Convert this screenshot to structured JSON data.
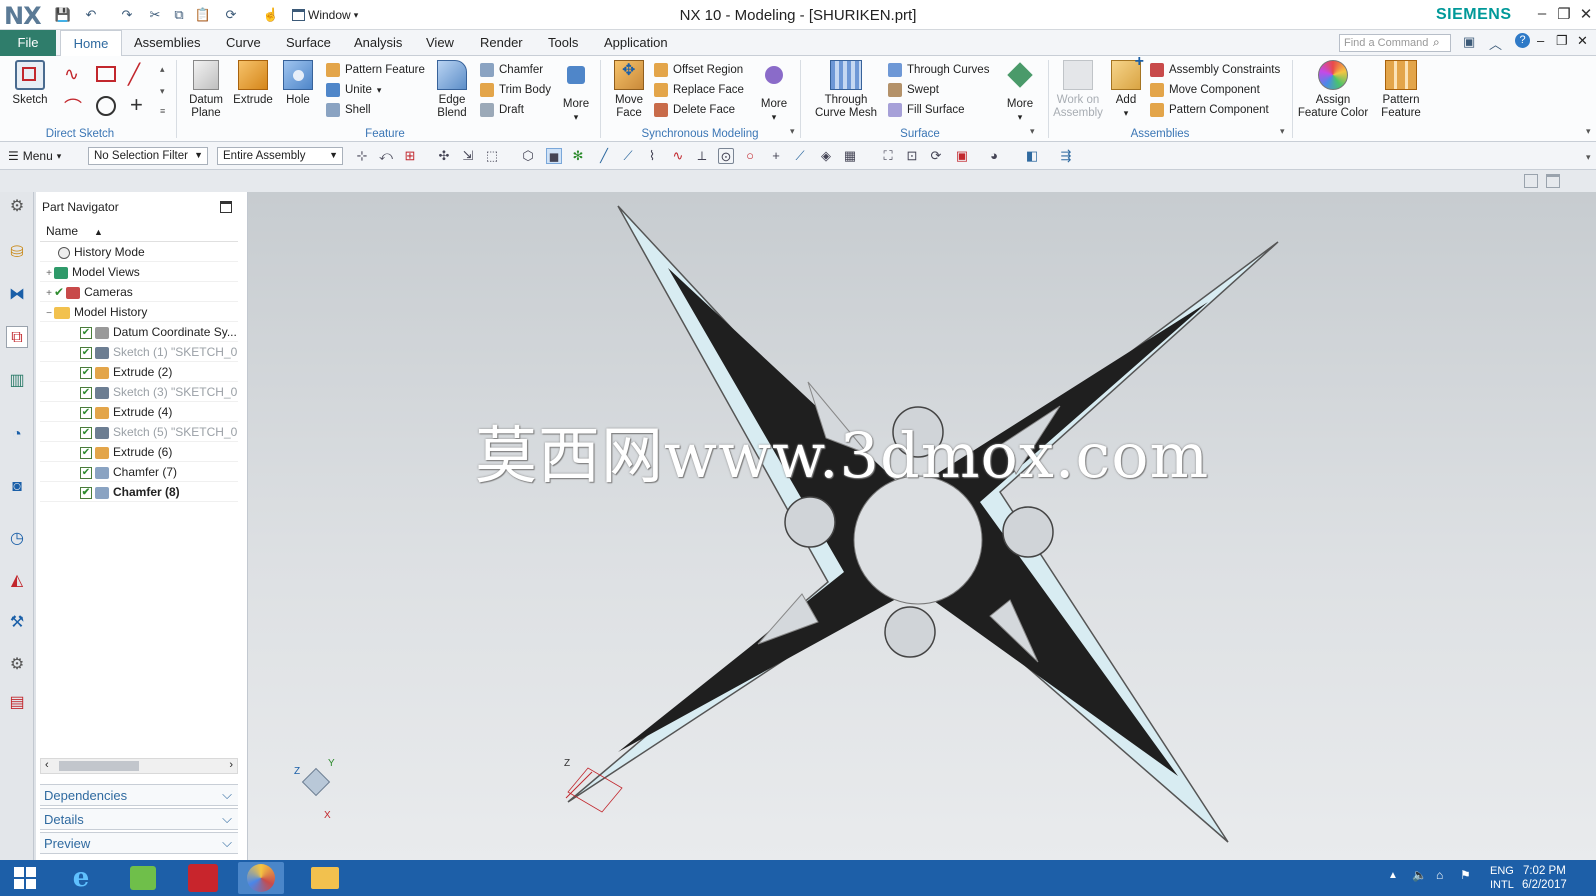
{
  "titlebar": {
    "app_logo": "NX",
    "window_menu": "Window",
    "title": "NX 10 - Modeling - [SHURIKEN.prt]",
    "brand": "SIEMENS"
  },
  "menu_tabs": [
    "File",
    "Home",
    "Assemblies",
    "Curve",
    "Surface",
    "Analysis",
    "View",
    "Render",
    "Tools",
    "Application"
  ],
  "active_tab": "Home",
  "find_command_placeholder": "Find a Command",
  "ribbon": {
    "sketch": "Sketch",
    "direct_sketch_group": "Direct Sketch",
    "datum_plane": [
      "Datum",
      "Plane"
    ],
    "extrude": "Extrude",
    "hole": "Hole",
    "pattern_feature": "Pattern Feature",
    "unite": "Unite",
    "shell": "Shell",
    "edge_blend": [
      "Edge",
      "Blend"
    ],
    "chamfer": "Chamfer",
    "trim_body": "Trim Body",
    "draft": "Draft",
    "more1": "More",
    "feature_group": "Feature",
    "move_face": [
      "Move",
      "Face"
    ],
    "offset_region": "Offset Region",
    "replace_face": "Replace Face",
    "delete_face": "Delete Face",
    "more2": "More",
    "sync_group": "Synchronous Modeling",
    "through_curve_mesh": [
      "Through",
      "Curve Mesh"
    ],
    "through_curves": "Through Curves",
    "swept": "Swept",
    "fill_surface": "Fill Surface",
    "more3": "More",
    "surface_group": "Surface",
    "work_on_assembly": [
      "Work on",
      "Assembly"
    ],
    "add": "Add",
    "assembly_constraints": "Assembly Constraints",
    "move_component": "Move Component",
    "pattern_component": "Pattern Component",
    "assemblies_group": "Assemblies",
    "assign_feature_color": [
      "Assign",
      "Feature Color"
    ],
    "pattern_feature_big": [
      "Pattern",
      "Feature"
    ]
  },
  "toolbar2": {
    "menu": "Menu",
    "selection_filter": "No Selection Filter",
    "scope": "Entire Assembly"
  },
  "navigator": {
    "title": "Part Navigator",
    "column": "Name",
    "items": [
      {
        "label": "History Mode",
        "expander": "",
        "checked": false
      },
      {
        "label": "Model Views",
        "expander": "+",
        "checked": false
      },
      {
        "label": "Cameras",
        "expander": "+",
        "checked": true
      },
      {
        "label": "Model History",
        "expander": "−",
        "checked": false
      },
      {
        "label": "Datum Coordinate Sy...",
        "expander": "",
        "checked": true
      },
      {
        "label": "Sketch (1) \"SKETCH_0...",
        "expander": "",
        "checked": true
      },
      {
        "label": "Extrude (2)",
        "expander": "",
        "checked": true
      },
      {
        "label": "Sketch (3) \"SKETCH_0...",
        "expander": "",
        "checked": true
      },
      {
        "label": "Extrude (4)",
        "expander": "",
        "checked": true
      },
      {
        "label": "Sketch (5) \"SKETCH_0...",
        "expander": "",
        "checked": true
      },
      {
        "label": "Extrude (6)",
        "expander": "",
        "checked": true
      },
      {
        "label": "Chamfer (7)",
        "expander": "",
        "checked": true
      },
      {
        "label": "Chamfer (8)",
        "expander": "",
        "checked": true
      }
    ],
    "panels": [
      "Dependencies",
      "Details",
      "Preview"
    ]
  },
  "viewport": {
    "watermark": "莫西网www.3dmox.com",
    "axis_x": "X",
    "axis_y": "Y",
    "axis_z": "Z"
  },
  "taskbar": {
    "lang1": "ENG",
    "lang2": "INTL",
    "time": "7:02 PM",
    "date": "6/2/2017"
  }
}
